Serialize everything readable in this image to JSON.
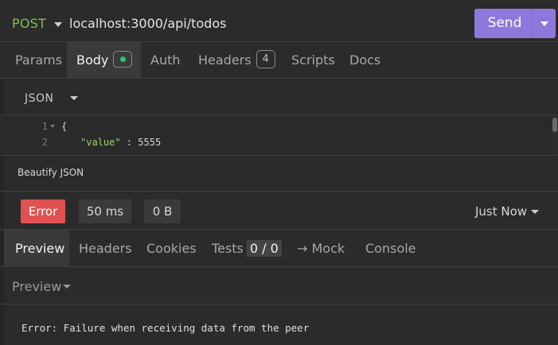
{
  "request": {
    "method": "POST",
    "url": "localhost:3000/api/todos",
    "send_label": "Send"
  },
  "request_tabs": [
    {
      "label": "Params"
    },
    {
      "label": "Body"
    },
    {
      "label": "Auth"
    },
    {
      "label": "Headers",
      "badge": "4"
    },
    {
      "label": "Scripts"
    },
    {
      "label": "Docs"
    }
  ],
  "body": {
    "type": "JSON",
    "lines": [
      {
        "num": "1",
        "text": "{"
      },
      {
        "num": "2",
        "key": "\"value\"",
        "sep": " : ",
        "value": "5555"
      }
    ],
    "beautify_label": "Beautify JSON"
  },
  "response": {
    "status": "Error",
    "time": "50 ms",
    "size": "0 B",
    "history": "Just Now",
    "tabs": [
      {
        "label": "Preview"
      },
      {
        "label": "Headers"
      },
      {
        "label": "Cookies"
      },
      {
        "label": "Tests",
        "badge": "0 / 0"
      },
      {
        "label": "→ Mock"
      },
      {
        "label": "Console"
      }
    ],
    "preview_mode": "Preview",
    "message": "Error: Failure when receiving data from the peer"
  },
  "colors": {
    "method": "#7fc04a",
    "send": "#8f78db",
    "error": "#e05252",
    "body_dot": "#33c26a"
  }
}
